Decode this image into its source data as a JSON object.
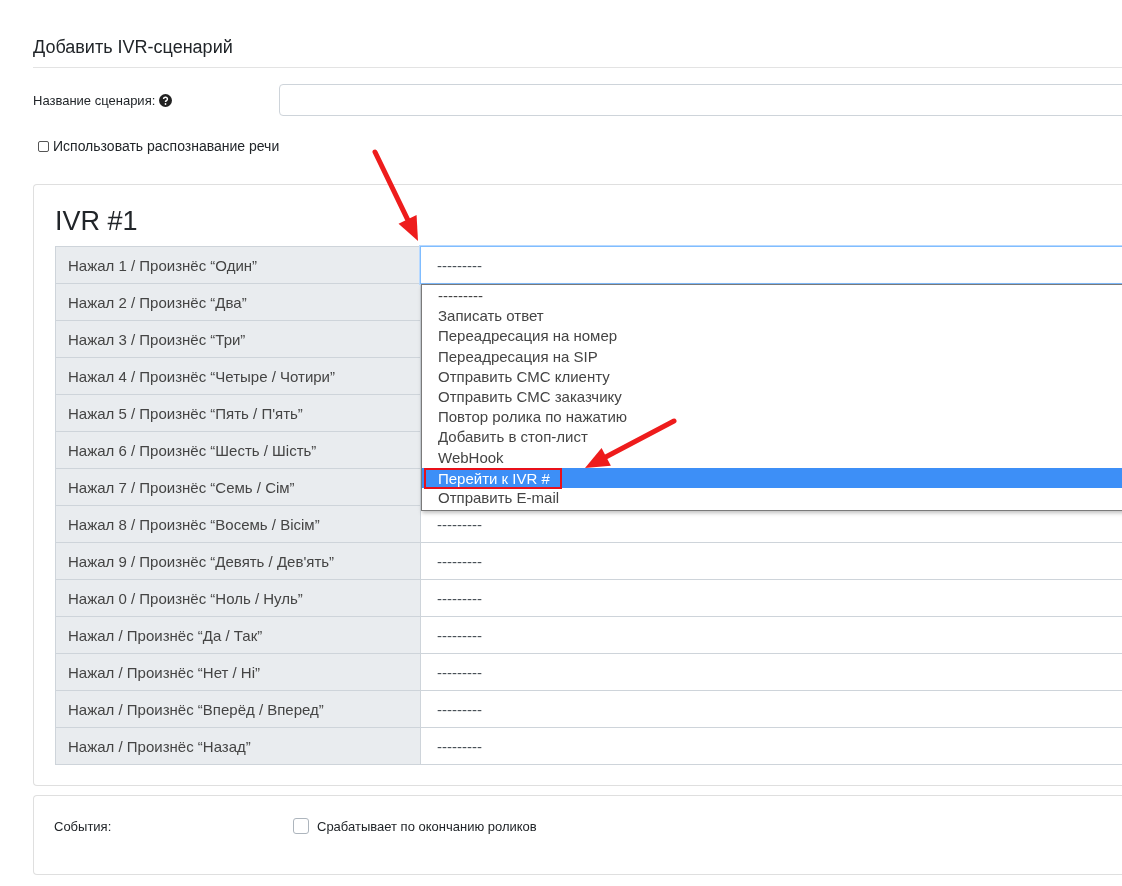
{
  "page_title": "Добавить IVR-сценарий",
  "name_field": {
    "label": "Название сценария:"
  },
  "speech_recognition": {
    "label": "Использовать распознавание речи",
    "checked": false
  },
  "ivr": {
    "title": "IVR #1",
    "rows": [
      {
        "label": "Нажал 1 / Произнёс  “Один”",
        "value": "---------",
        "focused": true
      },
      {
        "label": "Нажал 2 / Произнёс  “Два”"
      },
      {
        "label": "Нажал 3 / Произнёс  “Три”"
      },
      {
        "label": "Нажал 4 / Произнёс  “Четыре / Чотири”"
      },
      {
        "label": "Нажал 5 / Произнёс  “Пять / П'ять”"
      },
      {
        "label": "Нажал 6 / Произнёс  “Шесть / Шість”"
      },
      {
        "label": "Нажал 7 / Произнёс  “Семь / Сім”"
      },
      {
        "label": "Нажал 8 / Произнёс  “Восемь / Вісім”",
        "value": "---------",
        "focused": false
      },
      {
        "label": "Нажал 9 / Произнёс  “Девять / Дев'ять”",
        "value": "---------",
        "focused": false
      },
      {
        "label": "Нажал 0 / Произнёс  “Ноль / Нуль”",
        "value": "---------",
        "focused": false
      },
      {
        "label": "Нажал / Произнёс  “Да / Так”",
        "value": "---------",
        "focused": false
      },
      {
        "label": "Нажал / Произнёс  “Нет / Ні”",
        "value": "---------",
        "focused": false
      },
      {
        "label": "Нажал / Произнёс  “Вперёд / Вперед”",
        "value": "---------",
        "focused": false
      },
      {
        "label": "Нажал / Произнёс  “Назад”",
        "value": "---------",
        "focused": false
      }
    ],
    "dropdown": {
      "options": [
        {
          "label": "---------",
          "selected": false,
          "outlined": false
        },
        {
          "label": "Записать ответ",
          "selected": false,
          "outlined": false
        },
        {
          "label": "Переадресация на номер",
          "selected": false,
          "outlined": false
        },
        {
          "label": "Переадресация на SIP",
          "selected": false,
          "outlined": false
        },
        {
          "label": "Отправить СМС клиенту",
          "selected": false,
          "outlined": false
        },
        {
          "label": "Отправить СМС заказчику",
          "selected": false,
          "outlined": false
        },
        {
          "label": "Повтор ролика по нажатию",
          "selected": false,
          "outlined": false
        },
        {
          "label": "Добавить в стоп-лист",
          "selected": false,
          "outlined": false
        },
        {
          "label": "WebHook",
          "selected": false,
          "outlined": false
        },
        {
          "label": "Перейти к IVR #",
          "selected": true,
          "outlined": true
        },
        {
          "label": "Отправить E-mail",
          "selected": false,
          "outlined": false
        }
      ]
    }
  },
  "events": {
    "label": "События:",
    "option": {
      "label": "Срабатывает по окончанию роликов",
      "checked": false
    }
  }
}
